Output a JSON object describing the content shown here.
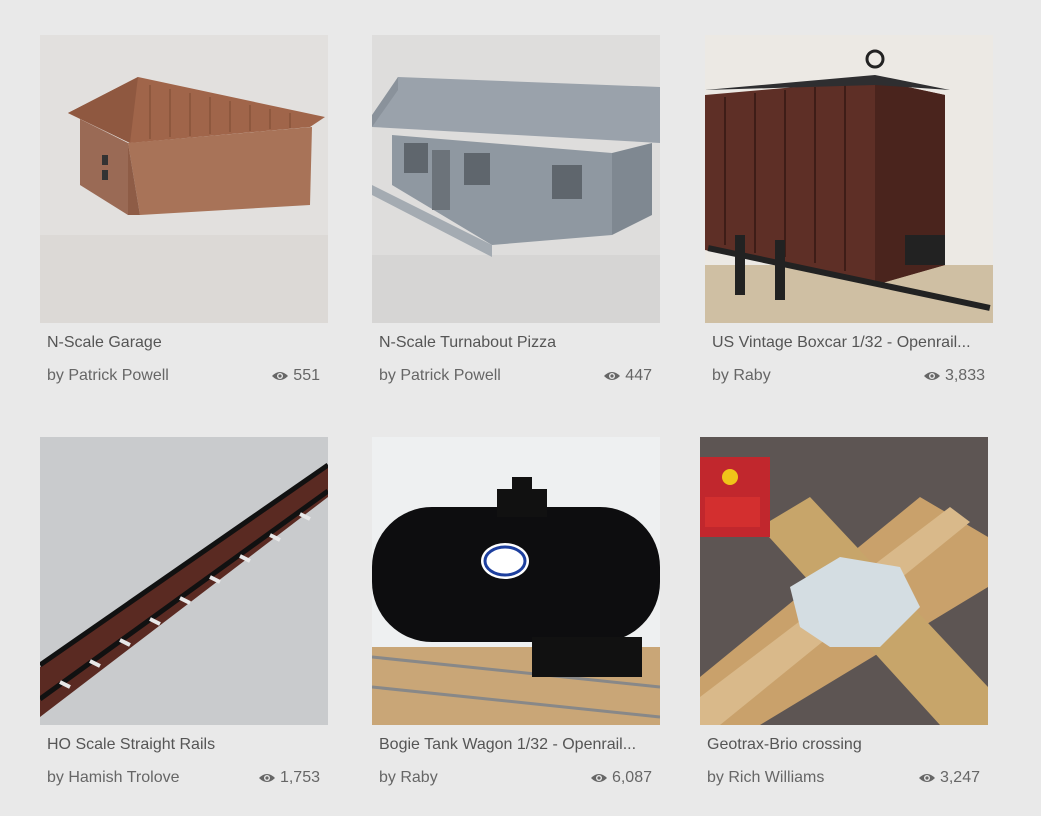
{
  "items": [
    {
      "title": "N-Scale Garage",
      "author": "by Patrick Powell",
      "views": "551",
      "image": "n-scale-garage-model"
    },
    {
      "title": "N-Scale Turnabout Pizza",
      "author": "by Patrick Powell",
      "views": "447",
      "image": "n-scale-pizza-building-model"
    },
    {
      "title": "US Vintage Boxcar 1/32 - Openrail...",
      "author": "by Raby",
      "views": "3,833",
      "image": "vintage-boxcar-model"
    },
    {
      "title": "HO Scale Straight Rails",
      "author": "by Hamish Trolove",
      "views": "1,753",
      "image": "ho-scale-rails-model"
    },
    {
      "title": "Bogie Tank Wagon 1/32 - Openrail...",
      "author": "by Raby",
      "views": "6,087",
      "image": "tank-wagon-model"
    },
    {
      "title": "Geotrax-Brio crossing",
      "author": "by Rich Williams",
      "views": "3,247",
      "image": "geotrax-brio-crossing-model"
    }
  ],
  "icons": {
    "views": "eye-icon"
  },
  "colors": {
    "background": "#e9e9e9",
    "text": "#555555"
  }
}
